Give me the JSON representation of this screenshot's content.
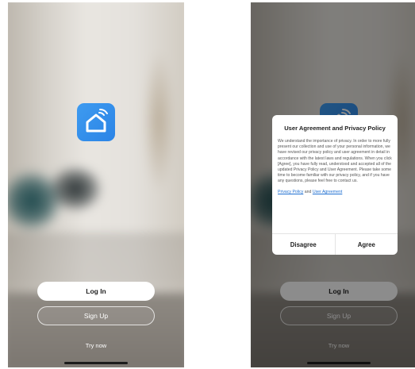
{
  "welcome": {
    "login_label": "Log In",
    "signup_label": "Sign Up",
    "try_now_label": "Try now",
    "logo_icon": "home-wifi-icon",
    "logo_color": "#2f8ff0"
  },
  "dialog": {
    "title": "User Agreement and Privacy Policy",
    "body": "We understand the importance of privacy. In order to more fully present our collection and use of your personal information, we have revised our privacy policy and user agreement in detail in accordance with the latest laws and regulations. When you click [Agree], you have fully read, understood and accepted all of the updated Privacy Policy and User Agreement. Please take some time to become familiar with our privacy policy, and if you have any questions, please feel free to contact us.",
    "privacy_link": "Privacy Policy",
    "and_text": " and ",
    "agreement_link": "User Agreement",
    "disagree_label": "Disagree",
    "agree_label": "Agree"
  }
}
